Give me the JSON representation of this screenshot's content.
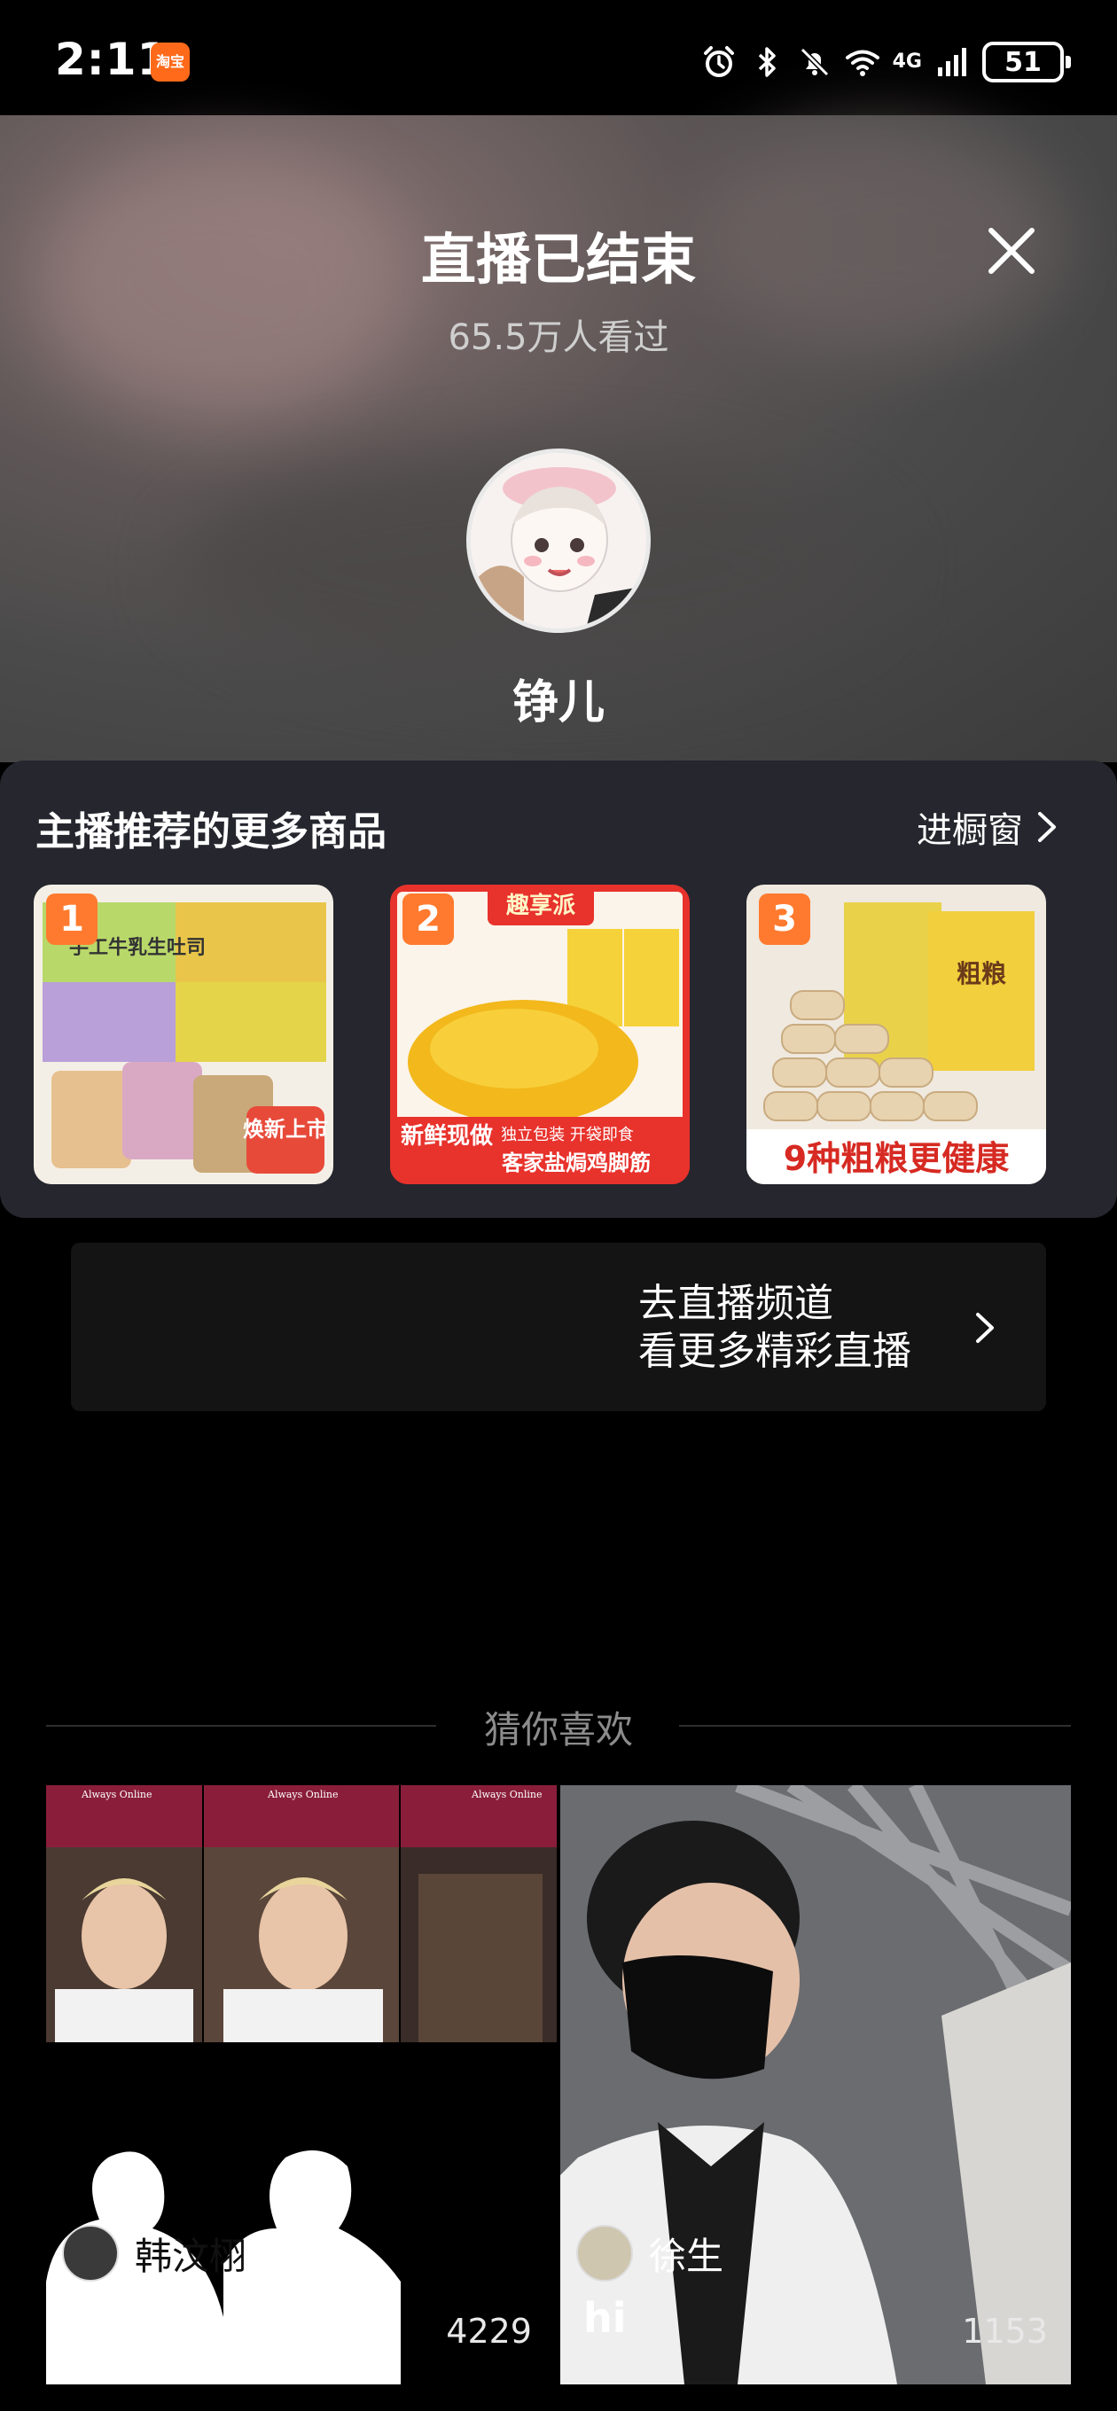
{
  "status_bar": {
    "time": "2:11",
    "app_icon_label": "淘宝",
    "network": "4G",
    "battery": "51",
    "icons": [
      "alarm-icon",
      "bluetooth-icon",
      "mute-icon",
      "wifi-icon",
      "signal-icon",
      "battery-icon"
    ]
  },
  "live_ended": {
    "title": "直播已结束",
    "viewers": "65.5万人看过",
    "streamer_name": "铮儿",
    "close_icon": "close-icon"
  },
  "products_panel": {
    "title": "主播推荐的更多商品",
    "link_label": "进橱窗",
    "items": [
      {
        "rank": "1",
        "label": "手工牛乳生吐司",
        "tag": "焕新上市"
      },
      {
        "rank": "2",
        "label": "趣享派",
        "tag": "新鲜现做",
        "caption": "客家盐焗鸡脚筋",
        "sub_caption": "独立包装 开袋即食"
      },
      {
        "rank": "3",
        "label": "粗粮",
        "caption": "9种粗粮更健康"
      }
    ]
  },
  "live_channel": {
    "line1": "去直播频道",
    "line2": "看更多精彩直播"
  },
  "guess": {
    "title": "猜你喜欢",
    "cards": [
      {
        "user": "韩汶栩",
        "count": "4229",
        "thumb_text": "Always Online"
      },
      {
        "user": "徐生",
        "caption": "hi",
        "count": "1153"
      }
    ]
  },
  "colors": {
    "background": "#000000",
    "panel": "#25262e",
    "accent": "#ff7a2e"
  }
}
